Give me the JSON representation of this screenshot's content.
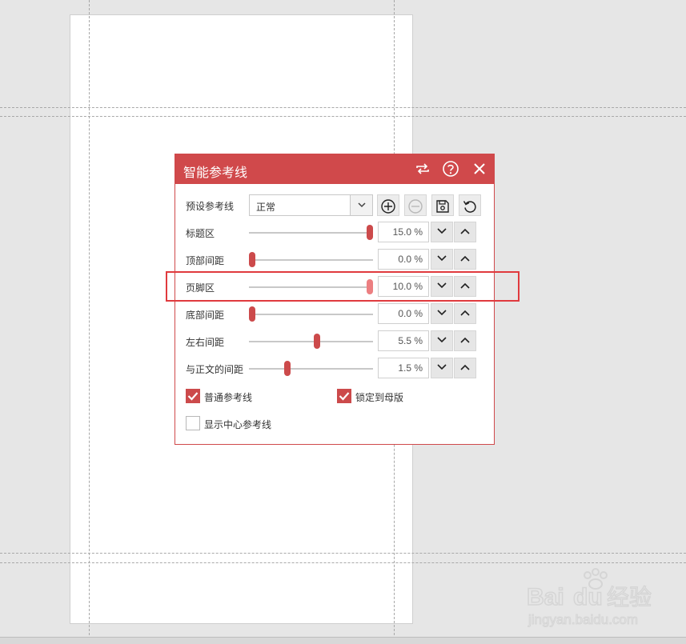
{
  "dialog": {
    "title": "智能参考线",
    "preset": {
      "label": "预设参考线",
      "selected": "正常"
    },
    "sliders": [
      {
        "label": "标题区",
        "value": "15.0 %",
        "level": 1.0,
        "active": false
      },
      {
        "label": "顶部间距",
        "value": "0.0 %",
        "level": 0.0,
        "active": false
      },
      {
        "label": "页脚区",
        "value": "10.0 %",
        "level": 1.0,
        "active": true
      },
      {
        "label": "底部间距",
        "value": "0.0 %",
        "level": 0.0,
        "active": false
      },
      {
        "label": "左右间距",
        "value": "5.5 %",
        "level": 0.55,
        "active": false
      },
      {
        "label": "与正文的间距",
        "value": "1.5 %",
        "level": 0.3,
        "active": false
      }
    ],
    "checkboxes": {
      "normal_guides": {
        "label": "普通参考线",
        "checked": true
      },
      "lock_master": {
        "label": "锁定到母版",
        "checked": true
      },
      "center_guides": {
        "label": "显示中心参考线",
        "checked": false
      }
    }
  },
  "colors": {
    "accent": "#d0494b",
    "highlight": "#e03a3e"
  },
  "watermark": {
    "brand": "Baidu经验",
    "url": "jingyan.baidu.com"
  }
}
